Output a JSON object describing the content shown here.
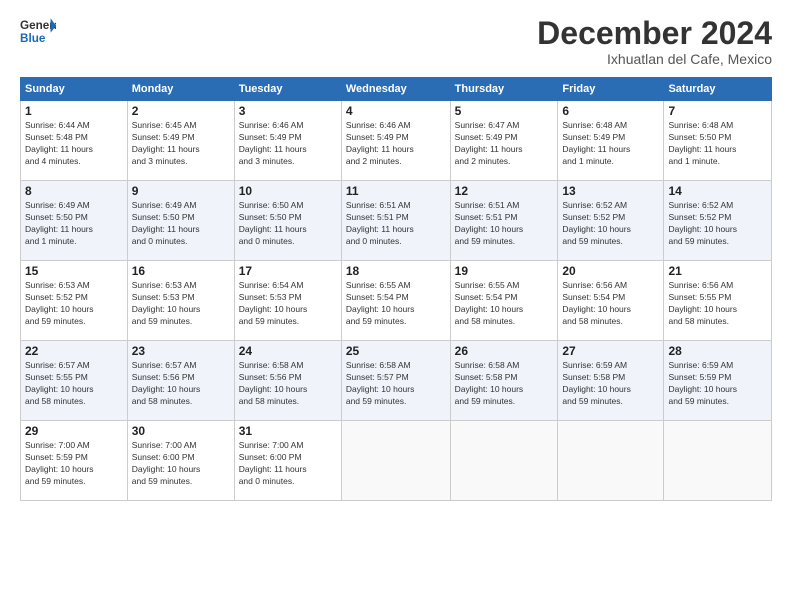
{
  "logo": {
    "line1": "General",
    "line2": "Blue"
  },
  "header": {
    "month": "December 2024",
    "location": "Ixhuatlan del Cafe, Mexico"
  },
  "columns": [
    "Sunday",
    "Monday",
    "Tuesday",
    "Wednesday",
    "Thursday",
    "Friday",
    "Saturday"
  ],
  "weeks": [
    [
      {
        "day": "1",
        "info": "Sunrise: 6:44 AM\nSunset: 5:48 PM\nDaylight: 11 hours\nand 4 minutes."
      },
      {
        "day": "2",
        "info": "Sunrise: 6:45 AM\nSunset: 5:49 PM\nDaylight: 11 hours\nand 3 minutes."
      },
      {
        "day": "3",
        "info": "Sunrise: 6:46 AM\nSunset: 5:49 PM\nDaylight: 11 hours\nand 3 minutes."
      },
      {
        "day": "4",
        "info": "Sunrise: 6:46 AM\nSunset: 5:49 PM\nDaylight: 11 hours\nand 2 minutes."
      },
      {
        "day": "5",
        "info": "Sunrise: 6:47 AM\nSunset: 5:49 PM\nDaylight: 11 hours\nand 2 minutes."
      },
      {
        "day": "6",
        "info": "Sunrise: 6:48 AM\nSunset: 5:49 PM\nDaylight: 11 hours\nand 1 minute."
      },
      {
        "day": "7",
        "info": "Sunrise: 6:48 AM\nSunset: 5:50 PM\nDaylight: 11 hours\nand 1 minute."
      }
    ],
    [
      {
        "day": "8",
        "info": "Sunrise: 6:49 AM\nSunset: 5:50 PM\nDaylight: 11 hours\nand 1 minute."
      },
      {
        "day": "9",
        "info": "Sunrise: 6:49 AM\nSunset: 5:50 PM\nDaylight: 11 hours\nand 0 minutes."
      },
      {
        "day": "10",
        "info": "Sunrise: 6:50 AM\nSunset: 5:50 PM\nDaylight: 11 hours\nand 0 minutes."
      },
      {
        "day": "11",
        "info": "Sunrise: 6:51 AM\nSunset: 5:51 PM\nDaylight: 11 hours\nand 0 minutes."
      },
      {
        "day": "12",
        "info": "Sunrise: 6:51 AM\nSunset: 5:51 PM\nDaylight: 10 hours\nand 59 minutes."
      },
      {
        "day": "13",
        "info": "Sunrise: 6:52 AM\nSunset: 5:52 PM\nDaylight: 10 hours\nand 59 minutes."
      },
      {
        "day": "14",
        "info": "Sunrise: 6:52 AM\nSunset: 5:52 PM\nDaylight: 10 hours\nand 59 minutes."
      }
    ],
    [
      {
        "day": "15",
        "info": "Sunrise: 6:53 AM\nSunset: 5:52 PM\nDaylight: 10 hours\nand 59 minutes."
      },
      {
        "day": "16",
        "info": "Sunrise: 6:53 AM\nSunset: 5:53 PM\nDaylight: 10 hours\nand 59 minutes."
      },
      {
        "day": "17",
        "info": "Sunrise: 6:54 AM\nSunset: 5:53 PM\nDaylight: 10 hours\nand 59 minutes."
      },
      {
        "day": "18",
        "info": "Sunrise: 6:55 AM\nSunset: 5:54 PM\nDaylight: 10 hours\nand 59 minutes."
      },
      {
        "day": "19",
        "info": "Sunrise: 6:55 AM\nSunset: 5:54 PM\nDaylight: 10 hours\nand 58 minutes."
      },
      {
        "day": "20",
        "info": "Sunrise: 6:56 AM\nSunset: 5:54 PM\nDaylight: 10 hours\nand 58 minutes."
      },
      {
        "day": "21",
        "info": "Sunrise: 6:56 AM\nSunset: 5:55 PM\nDaylight: 10 hours\nand 58 minutes."
      }
    ],
    [
      {
        "day": "22",
        "info": "Sunrise: 6:57 AM\nSunset: 5:55 PM\nDaylight: 10 hours\nand 58 minutes."
      },
      {
        "day": "23",
        "info": "Sunrise: 6:57 AM\nSunset: 5:56 PM\nDaylight: 10 hours\nand 58 minutes."
      },
      {
        "day": "24",
        "info": "Sunrise: 6:58 AM\nSunset: 5:56 PM\nDaylight: 10 hours\nand 58 minutes."
      },
      {
        "day": "25",
        "info": "Sunrise: 6:58 AM\nSunset: 5:57 PM\nDaylight: 10 hours\nand 59 minutes."
      },
      {
        "day": "26",
        "info": "Sunrise: 6:58 AM\nSunset: 5:58 PM\nDaylight: 10 hours\nand 59 minutes."
      },
      {
        "day": "27",
        "info": "Sunrise: 6:59 AM\nSunset: 5:58 PM\nDaylight: 10 hours\nand 59 minutes."
      },
      {
        "day": "28",
        "info": "Sunrise: 6:59 AM\nSunset: 5:59 PM\nDaylight: 10 hours\nand 59 minutes."
      }
    ],
    [
      {
        "day": "29",
        "info": "Sunrise: 7:00 AM\nSunset: 5:59 PM\nDaylight: 10 hours\nand 59 minutes."
      },
      {
        "day": "30",
        "info": "Sunrise: 7:00 AM\nSunset: 6:00 PM\nDaylight: 10 hours\nand 59 minutes."
      },
      {
        "day": "31",
        "info": "Sunrise: 7:00 AM\nSunset: 6:00 PM\nDaylight: 11 hours\nand 0 minutes."
      },
      null,
      null,
      null,
      null
    ]
  ]
}
